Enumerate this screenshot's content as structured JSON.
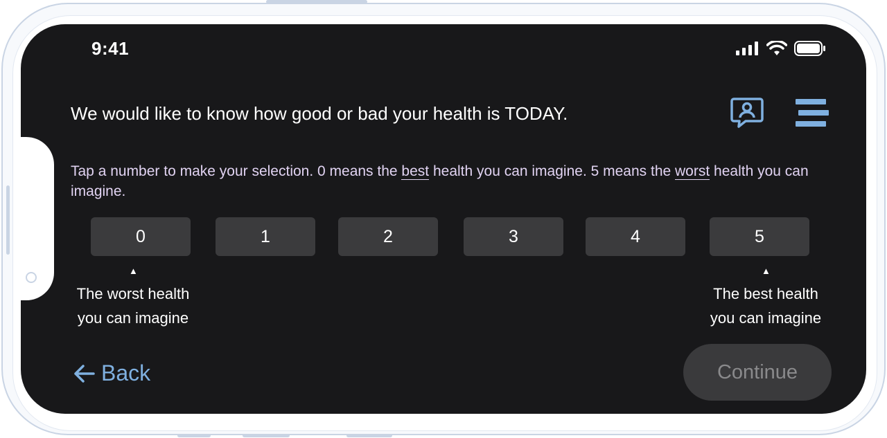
{
  "status_bar": {
    "time": "9:41"
  },
  "header": {
    "question": "We would like to know how good or bad your health is TODAY.",
    "chat_icon": "chat-person-icon",
    "menu_icon": "menu-icon"
  },
  "instructions": {
    "part1": "Tap a number to make your selection. 0 means the ",
    "best": "best",
    "part2": " health you can imagine. 5 means the ",
    "worst": "worst",
    "part3": " health you can imagine."
  },
  "scale": {
    "options": [
      "0",
      "1",
      "2",
      "3",
      "4",
      "5"
    ],
    "left_anchor_line1": "The worst health",
    "left_anchor_line2": "you can imagine",
    "right_anchor_line1": "The best health",
    "right_anchor_line2": "you can imagine"
  },
  "footer": {
    "back_label": "Back",
    "continue_label": "Continue"
  },
  "colors": {
    "background": "#18181a",
    "accent": "#7fb0e0",
    "instruction_text": "#e1d3f2",
    "button_bg": "#3b3b3d"
  }
}
